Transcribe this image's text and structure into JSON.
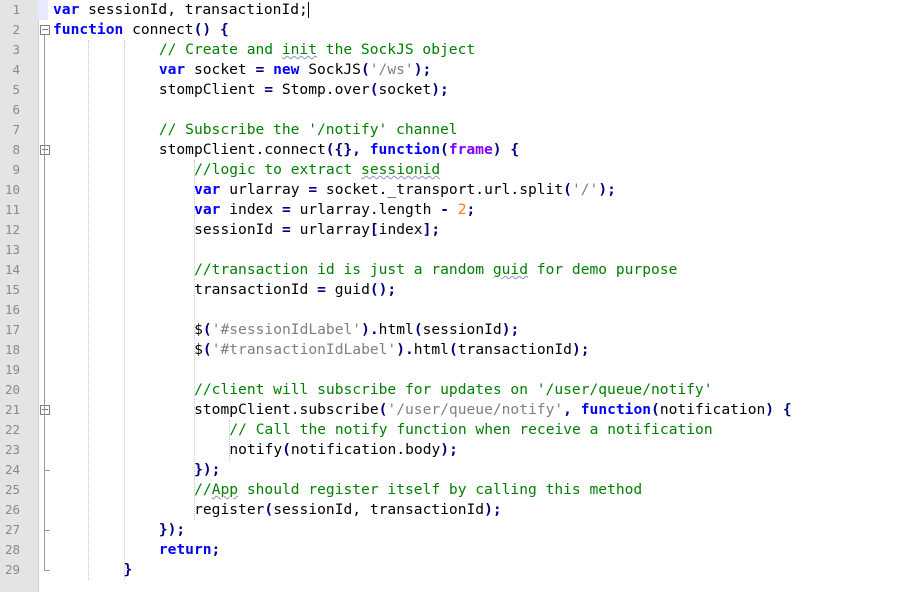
{
  "editor": {
    "line_numbers": [
      "1",
      "2",
      "3",
      "4",
      "5",
      "6",
      "7",
      "8",
      "9",
      "10",
      "11",
      "12",
      "13",
      "14",
      "15",
      "16",
      "17",
      "18",
      "19",
      "20",
      "21",
      "22",
      "23",
      "24",
      "25",
      "26",
      "27",
      "28",
      "29"
    ],
    "current_line": 1,
    "fold_markers": [
      2,
      8,
      21
    ],
    "colors": {
      "keyword": "#0000ff",
      "comment": "#008000",
      "string": "#808080",
      "number": "#ff8000",
      "operator": "#000080",
      "gutter": "#e4e4e4"
    },
    "lines": [
      {
        "indent": 0,
        "tokens": [
          {
            "t": "var",
            "c": "kw"
          },
          {
            "t": " sessionId, transactionId;",
            "c": ""
          }
        ]
      },
      {
        "indent": 0,
        "tokens": [
          {
            "t": "function",
            "c": "kw"
          },
          {
            "t": " connect",
            "c": ""
          },
          {
            "t": "()",
            "c": "op"
          },
          {
            "t": " ",
            "c": ""
          },
          {
            "t": "{",
            "c": "op"
          }
        ]
      },
      {
        "indent": 12,
        "tokens": [
          {
            "t": "// Create and ",
            "c": "cm"
          },
          {
            "t": "init",
            "c": "cm sq"
          },
          {
            "t": " the SockJS object",
            "c": "cm"
          }
        ]
      },
      {
        "indent": 12,
        "tokens": [
          {
            "t": "var",
            "c": "kw"
          },
          {
            "t": " socket ",
            "c": ""
          },
          {
            "t": "=",
            "c": "op"
          },
          {
            "t": " ",
            "c": ""
          },
          {
            "t": "new",
            "c": "kw"
          },
          {
            "t": " SockJS",
            "c": ""
          },
          {
            "t": "(",
            "c": "op"
          },
          {
            "t": "'/ws'",
            "c": "st"
          },
          {
            "t": ");",
            "c": "op"
          }
        ]
      },
      {
        "indent": 12,
        "tokens": [
          {
            "t": "stompClient ",
            "c": ""
          },
          {
            "t": "=",
            "c": "op"
          },
          {
            "t": " Stomp.over",
            "c": ""
          },
          {
            "t": "(",
            "c": "op"
          },
          {
            "t": "socket",
            "c": ""
          },
          {
            "t": ");",
            "c": "op"
          }
        ]
      },
      {
        "indent": 0,
        "tokens": []
      },
      {
        "indent": 12,
        "tokens": [
          {
            "t": "// Subscribe the '/notify' channel",
            "c": "cm"
          }
        ]
      },
      {
        "indent": 12,
        "tokens": [
          {
            "t": "stompClient.connect",
            "c": ""
          },
          {
            "t": "({},",
            "c": "op"
          },
          {
            "t": " ",
            "c": ""
          },
          {
            "t": "function",
            "c": "kw"
          },
          {
            "t": "(",
            "c": "op"
          },
          {
            "t": "frame",
            "c": "pm"
          },
          {
            "t": ")",
            "c": "op"
          },
          {
            "t": " ",
            "c": ""
          },
          {
            "t": "{",
            "c": "op"
          }
        ]
      },
      {
        "indent": 16,
        "tokens": [
          {
            "t": "//logic to extract ",
            "c": "cm"
          },
          {
            "t": "sessionid",
            "c": "cm sq"
          }
        ]
      },
      {
        "indent": 16,
        "tokens": [
          {
            "t": "var",
            "c": "kw"
          },
          {
            "t": " urlarray ",
            "c": ""
          },
          {
            "t": "=",
            "c": "op"
          },
          {
            "t": " socket._transport.url.split",
            "c": ""
          },
          {
            "t": "(",
            "c": "op"
          },
          {
            "t": "'/'",
            "c": "st"
          },
          {
            "t": ");",
            "c": "op"
          }
        ]
      },
      {
        "indent": 16,
        "tokens": [
          {
            "t": "var",
            "c": "kw"
          },
          {
            "t": " index ",
            "c": ""
          },
          {
            "t": "=",
            "c": "op"
          },
          {
            "t": " urlarray.length ",
            "c": ""
          },
          {
            "t": "-",
            "c": "op"
          },
          {
            "t": " ",
            "c": ""
          },
          {
            "t": "2",
            "c": "nm"
          },
          {
            "t": ";",
            "c": "op"
          }
        ]
      },
      {
        "indent": 16,
        "tokens": [
          {
            "t": "sessionId ",
            "c": ""
          },
          {
            "t": "=",
            "c": "op"
          },
          {
            "t": " urlarray",
            "c": ""
          },
          {
            "t": "[",
            "c": "op"
          },
          {
            "t": "index",
            "c": ""
          },
          {
            "t": "];",
            "c": "op"
          }
        ]
      },
      {
        "indent": 0,
        "tokens": []
      },
      {
        "indent": 16,
        "tokens": [
          {
            "t": "//transaction id is just a random ",
            "c": "cm"
          },
          {
            "t": "guid",
            "c": "cm sq"
          },
          {
            "t": " for demo purpose",
            "c": "cm"
          }
        ]
      },
      {
        "indent": 16,
        "tokens": [
          {
            "t": "transactionId ",
            "c": ""
          },
          {
            "t": "=",
            "c": "op"
          },
          {
            "t": " guid",
            "c": ""
          },
          {
            "t": "();",
            "c": "op"
          }
        ]
      },
      {
        "indent": 0,
        "tokens": []
      },
      {
        "indent": 16,
        "tokens": [
          {
            "t": "$",
            "c": ""
          },
          {
            "t": "(",
            "c": "op"
          },
          {
            "t": "'#sessionIdLabel'",
            "c": "st"
          },
          {
            "t": ").",
            "c": "op"
          },
          {
            "t": "html",
            "c": ""
          },
          {
            "t": "(",
            "c": "op"
          },
          {
            "t": "sessionId",
            "c": ""
          },
          {
            "t": ");",
            "c": "op"
          }
        ]
      },
      {
        "indent": 16,
        "tokens": [
          {
            "t": "$",
            "c": ""
          },
          {
            "t": "(",
            "c": "op"
          },
          {
            "t": "'#transactionIdLabel'",
            "c": "st"
          },
          {
            "t": ").",
            "c": "op"
          },
          {
            "t": "html",
            "c": ""
          },
          {
            "t": "(",
            "c": "op"
          },
          {
            "t": "transactionId",
            "c": ""
          },
          {
            "t": ");",
            "c": "op"
          }
        ]
      },
      {
        "indent": 0,
        "tokens": []
      },
      {
        "indent": 16,
        "tokens": [
          {
            "t": "//client will subscribe for updates on '/user/queue/notify'",
            "c": "cm"
          }
        ]
      },
      {
        "indent": 16,
        "tokens": [
          {
            "t": "stompClient.subscribe",
            "c": ""
          },
          {
            "t": "(",
            "c": "op"
          },
          {
            "t": "'/user/queue/notify'",
            "c": "st"
          },
          {
            "t": ",",
            "c": "op"
          },
          {
            "t": " ",
            "c": ""
          },
          {
            "t": "function",
            "c": "kw"
          },
          {
            "t": "(",
            "c": "op"
          },
          {
            "t": "notification",
            "c": ""
          },
          {
            "t": ")",
            "c": "op"
          },
          {
            "t": " ",
            "c": ""
          },
          {
            "t": "{",
            "c": "op"
          }
        ]
      },
      {
        "indent": 20,
        "tokens": [
          {
            "t": "// Call the notify function when receive a notification",
            "c": "cm"
          }
        ]
      },
      {
        "indent": 20,
        "tokens": [
          {
            "t": "notify",
            "c": ""
          },
          {
            "t": "(",
            "c": "op"
          },
          {
            "t": "notification.body",
            "c": ""
          },
          {
            "t": ");",
            "c": "op"
          }
        ]
      },
      {
        "indent": 16,
        "tokens": [
          {
            "t": "});",
            "c": "op"
          }
        ]
      },
      {
        "indent": 16,
        "tokens": [
          {
            "t": "//",
            "c": "cm"
          },
          {
            "t": "App",
            "c": "cm sq"
          },
          {
            "t": " should register itself by calling this method",
            "c": "cm"
          }
        ]
      },
      {
        "indent": 16,
        "tokens": [
          {
            "t": "register",
            "c": ""
          },
          {
            "t": "(",
            "c": "op"
          },
          {
            "t": "sessionId, transactionId",
            "c": ""
          },
          {
            "t": ");",
            "c": "op"
          }
        ]
      },
      {
        "indent": 12,
        "tokens": [
          {
            "t": "});",
            "c": "op"
          }
        ]
      },
      {
        "indent": 12,
        "tokens": [
          {
            "t": "return",
            "c": "kw"
          },
          {
            "t": ";",
            "c": "op"
          }
        ]
      },
      {
        "indent": 8,
        "tokens": [
          {
            "t": "}",
            "c": "op"
          }
        ]
      }
    ]
  }
}
